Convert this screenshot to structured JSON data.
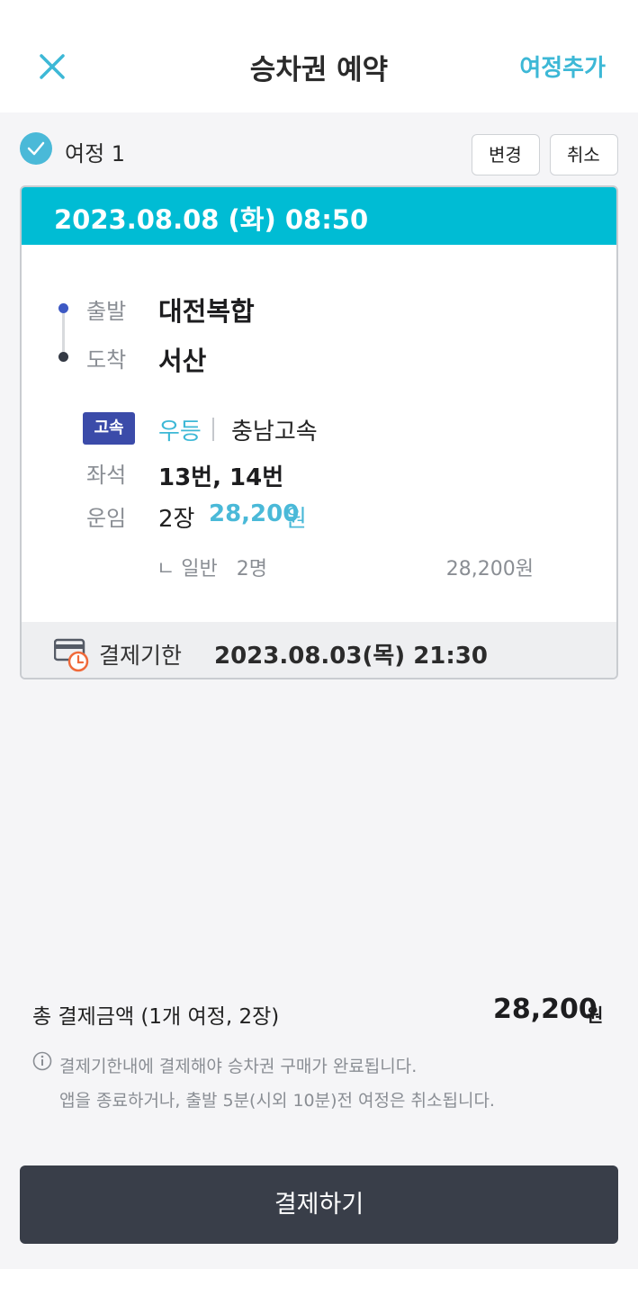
{
  "header": {
    "title": "승차권 예약",
    "add_trip": "여정추가"
  },
  "trip": {
    "title": "여정 1",
    "change_label": "변경",
    "cancel_label": "취소",
    "datetime": "2023.08.08 (화) 08:50",
    "departure_label": "출발",
    "departure": "대전복합",
    "arrival_label": "도착",
    "arrival": "서산",
    "bus_type": "고속",
    "grade": "우등",
    "company": "충남고속",
    "seat_label": "좌석",
    "seats": "13번, 14번",
    "fare_label": "운임",
    "ticket_count": "2장",
    "fare_amount": "28,200",
    "fare_unit": "원",
    "fare_detail": "ㄴ 일반   2명",
    "fare_detail_amount": "28,200원",
    "deadline_label": "결제기한",
    "deadline": "2023.08.03(목) 21:30"
  },
  "summary": {
    "total_label": "총 결제금액 (1개 여정, 2장)",
    "total_amount": "28,200",
    "total_unit": "원",
    "notice_line1": "결제기한내에 결제해야 승차권 구매가 완료됩니다.",
    "notice_line2": "앱을 종료하거나, 출발 5분(시외 10분)전 여정은 취소됩니다."
  },
  "pay_button": "결제하기",
  "colors": {
    "accent": "#00bcd4",
    "link": "#3db8d6",
    "badge": "#3b4ba9",
    "button_dark": "#393e49"
  }
}
